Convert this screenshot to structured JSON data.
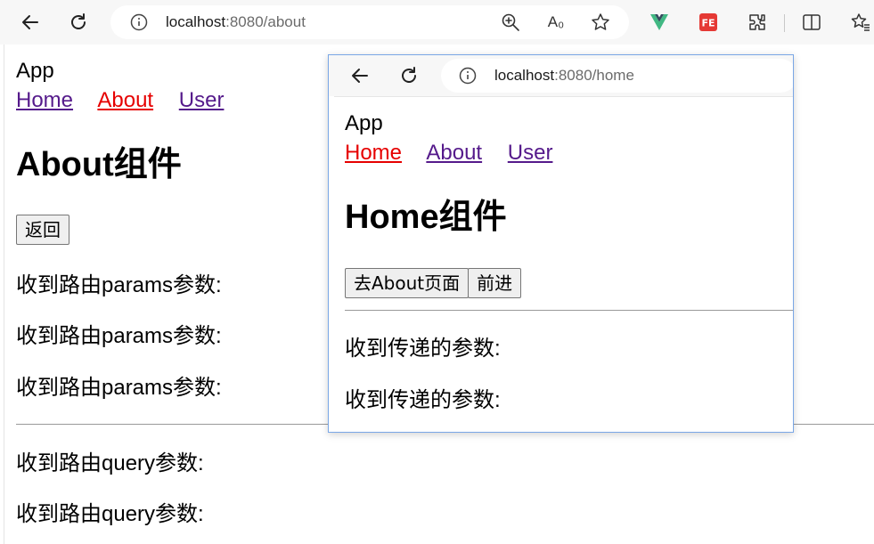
{
  "browser": {
    "url_host": "localhost",
    "url_path": ":8080/about",
    "icons": [
      "back-icon",
      "refresh-icon",
      "info-icon",
      "zoom-icon",
      "read-aloud-icon",
      "favorite-star-icon",
      "vue-devtools-icon",
      "fe-extension-icon",
      "extensions-icon",
      "split-screen-icon",
      "favorites-icon"
    ],
    "read_aloud_glyph": "A₀"
  },
  "page": {
    "app_title": "App",
    "nav": {
      "home": "Home",
      "about": "About",
      "user": "User"
    },
    "heading": "About组件",
    "back_button": "返回",
    "params_lines": [
      "收到路由params参数:",
      "收到路由params参数:",
      "收到路由params参数:"
    ],
    "query_lines": [
      "收到路由query参数:",
      "收到路由query参数:"
    ]
  },
  "popup": {
    "url_host": "localhost",
    "url_path": ":8080/home",
    "app_title": "App",
    "nav": {
      "home": "Home",
      "about": "About",
      "user": "User"
    },
    "heading": "Home组件",
    "goto_about_button": "去About页面",
    "forward_button": "前进",
    "passed_lines": [
      "收到传递的参数:",
      "收到传递的参数:"
    ]
  },
  "colors": {
    "active_link": "#e60000",
    "visited_link": "#551a8b",
    "popup_border": "#7aa7e6",
    "vue_green": "#41b883",
    "fe_red": "#e53935"
  }
}
